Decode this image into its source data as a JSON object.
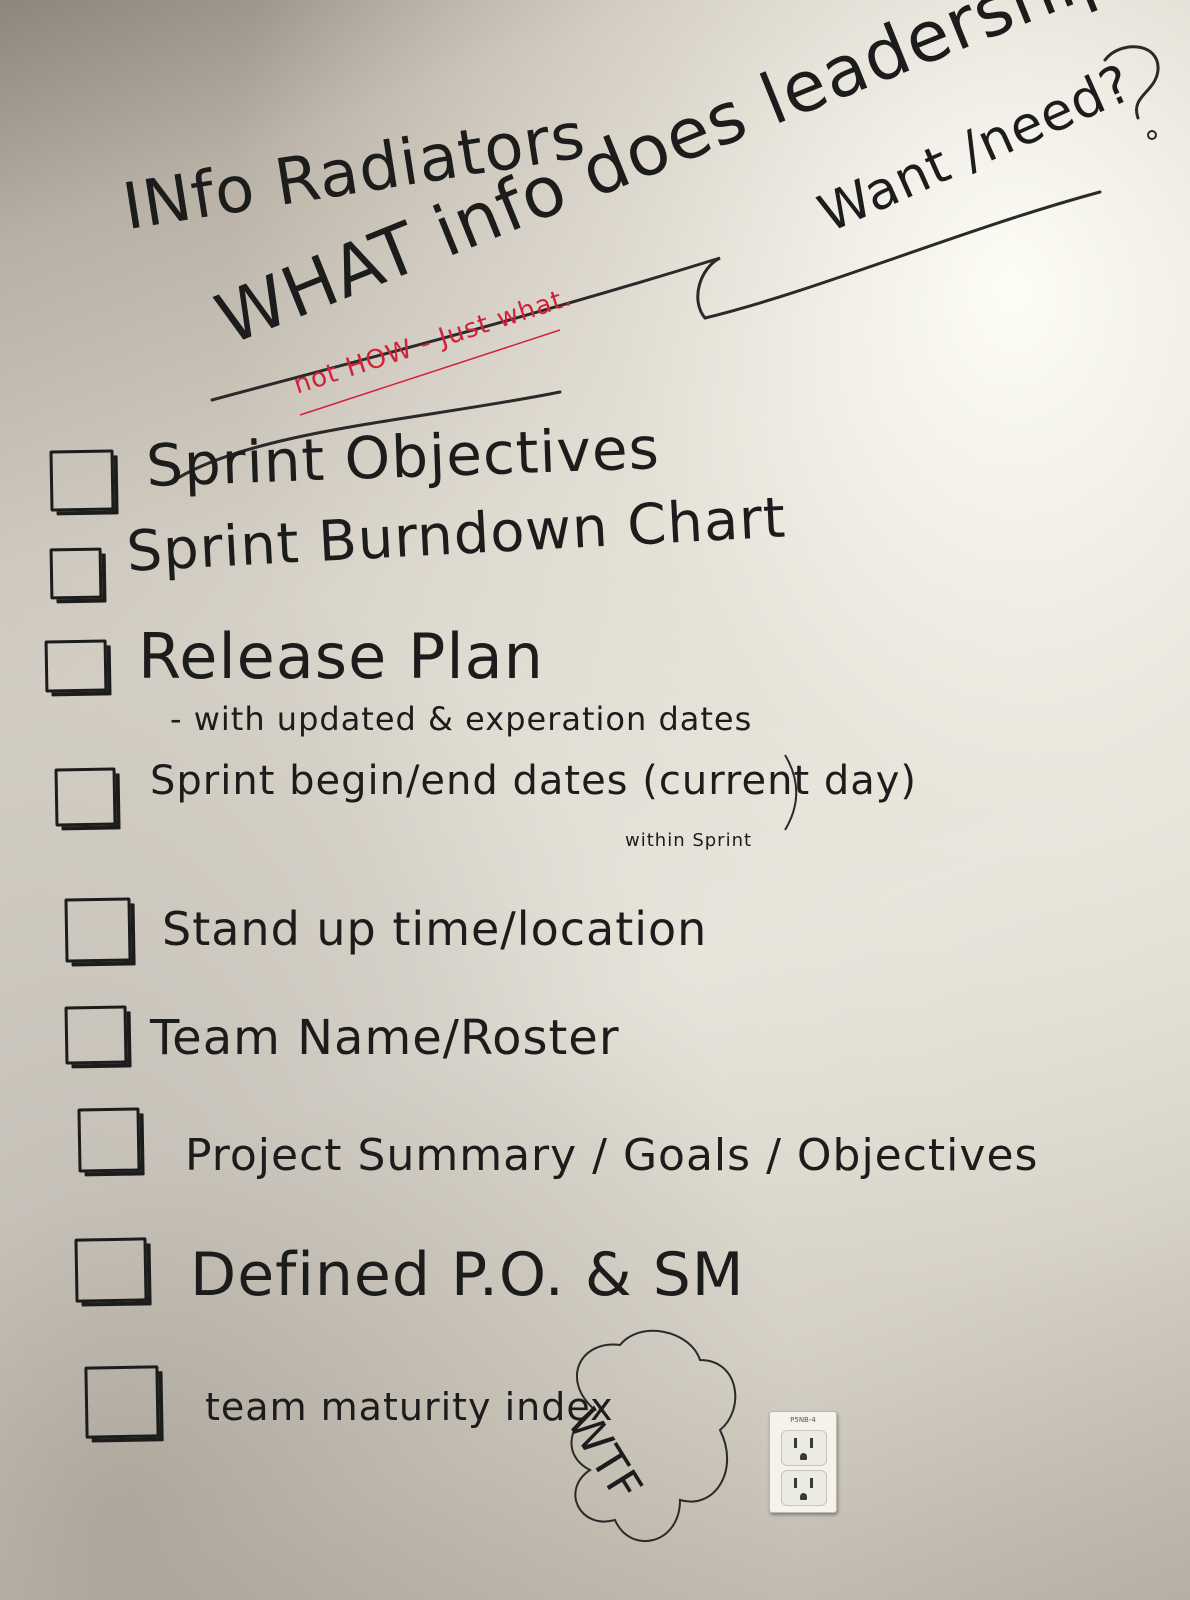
{
  "header": {
    "title": "INfo Radiators",
    "question_main": "WHAT info does leadership",
    "question_tail": "Want /need?",
    "note": "not HOW - Just what."
  },
  "checklist": {
    "items": [
      {
        "label": "Sprint Objectives",
        "sub": ""
      },
      {
        "label": "Sprint Burndown Chart",
        "sub": ""
      },
      {
        "label": "Release Plan",
        "sub": "- with updated & experation dates"
      },
      {
        "label": "Sprint begin/end dates (current day)",
        "sub": "within Sprint"
      },
      {
        "label": "Stand up time/location",
        "sub": ""
      },
      {
        "label": "Team Name/Roster",
        "sub": ""
      },
      {
        "label": "Project Summary / Goals / Objectives",
        "sub": ""
      },
      {
        "label": "Defined P.O. & SM",
        "sub": ""
      },
      {
        "label": "team maturity index",
        "sub": ""
      }
    ]
  },
  "doodle": {
    "cloud_text": "WTF"
  },
  "outlet": {
    "label": "P5NB-4"
  }
}
